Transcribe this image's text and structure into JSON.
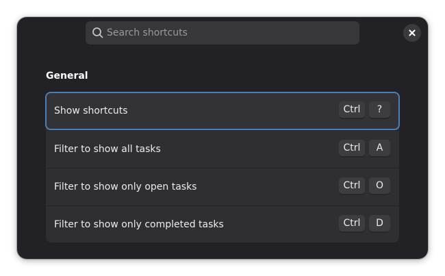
{
  "search": {
    "placeholder": "Search shortcuts"
  },
  "icons": {
    "search": "search-icon",
    "close": "close-icon"
  },
  "section": {
    "title": "General",
    "shortcuts": [
      {
        "label": "Show shortcuts",
        "modifier": "Ctrl",
        "key": "?",
        "focused": true
      },
      {
        "label": "Filter to show all tasks",
        "modifier": "Ctrl",
        "key": "A",
        "focused": false
      },
      {
        "label": "Filter to show only open tasks",
        "modifier": "Ctrl",
        "key": "O",
        "focused": false
      },
      {
        "label": "Filter to show only completed tasks",
        "modifier": "Ctrl",
        "key": "D",
        "focused": false
      }
    ]
  },
  "colors": {
    "dialog_background": "#222226",
    "list_background": "#2f2f33",
    "focus_ring": "#4b7fb8",
    "text": "#ececee",
    "placeholder_text": "#9a9a9e"
  }
}
